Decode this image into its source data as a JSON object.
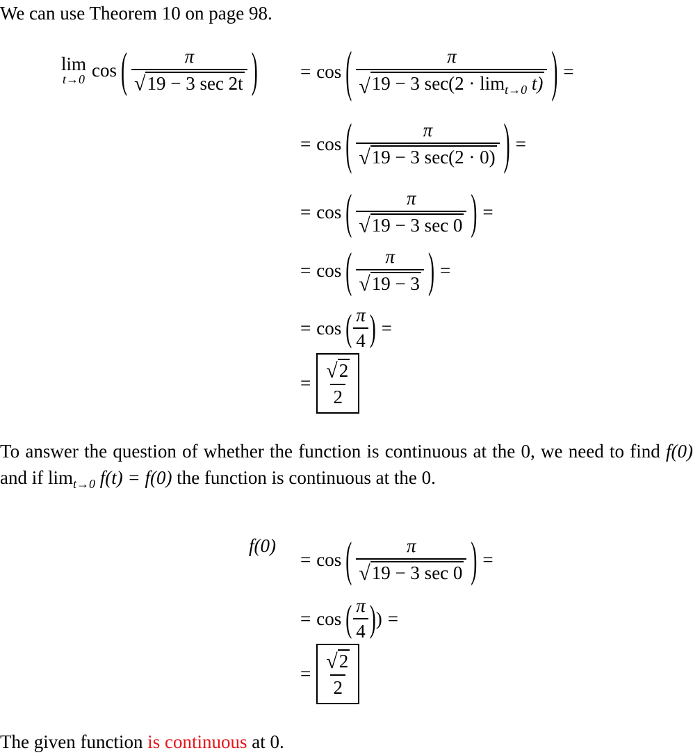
{
  "intro": "We can use Theorem 10 on page 98.",
  "limit_derivation": {
    "lhs": {
      "lim": "lim",
      "sub": "t→0",
      "fn": "cos",
      "num": "π",
      "den_sqrt": "19 − 3 sec 2t"
    },
    "steps": [
      {
        "fn": "cos",
        "num": "π",
        "den_sqrt_prefix": "19 − 3 sec(2 · lim",
        "den_sqrt_sub": "t→0",
        "den_sqrt_suffix": " t)",
        "trail": "="
      },
      {
        "fn": "cos",
        "num": "π",
        "den_sqrt": "19 − 3 sec(2 · 0)",
        "trail": "="
      },
      {
        "fn": "cos",
        "num": "π",
        "den_sqrt": "19 − 3 sec 0",
        "trail": "="
      },
      {
        "fn": "cos",
        "num": "π",
        "den_sqrt": "19 − 3",
        "trail": "="
      },
      {
        "fn": "cos",
        "num": "π",
        "den": "4",
        "trail": "="
      },
      {
        "answer_num_sqrt": "2",
        "answer_den": "2"
      }
    ]
  },
  "explanation": {
    "part1": "To answer the question of whether the function is continuous at the 0, we need to find ",
    "f0": "f(0)",
    "part2": " and if lim",
    "sub": "t→0",
    "part3": " f(t) = f(0)",
    "part4": " the function is continuous at the 0."
  },
  "f0_derivation": {
    "lhs": "f(0)",
    "steps": [
      {
        "fn": "cos",
        "num": "π",
        "den_sqrt": "19 − 3 sec 0",
        "trail": "="
      },
      {
        "fn": "cos",
        "num": "π",
        "den": "4",
        "extra": ")",
        "trail": "="
      },
      {
        "answer_num_sqrt": "2",
        "answer_den": "2"
      }
    ]
  },
  "conclusion": {
    "before": "The given function ",
    "highlight": "is continuous",
    "after": " at 0.",
    "highlight_color": "#e8141b"
  },
  "eq_sign": "="
}
